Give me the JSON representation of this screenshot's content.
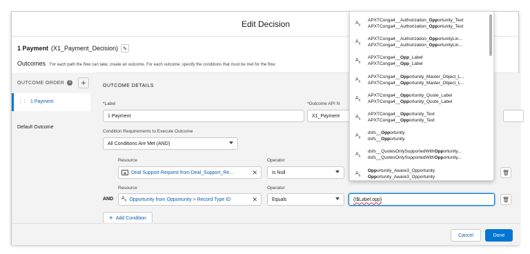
{
  "modal": {
    "title": "Edit Decision"
  },
  "decision": {
    "name": "1 Payment",
    "api_name": "(X1_Payment_Decision)"
  },
  "outcomes": {
    "title": "Outcomes",
    "description": "For each path the flow can take, create an outcome. For each outcome, specify the conditions that must be met for the flow"
  },
  "outcome_order": {
    "label": "OUTCOME ORDER",
    "items": [
      {
        "label": "1 Payment"
      }
    ],
    "default_outcome": "Default Outcome"
  },
  "details": {
    "title": "OUTCOME DETAILS",
    "label_field": {
      "label": "Label",
      "value": "1 Payment"
    },
    "api_field": {
      "label": "Outcome API N",
      "value": "X1_Payment"
    },
    "condition_req": {
      "label": "Condition Requirements to Execute Outcome",
      "value": "All Conditions Are Met (AND)"
    },
    "conditions": [
      {
        "resource_label": "Resource",
        "resource_value": "Deal Support Request from Deal_Support_Re...",
        "operator_label": "Operator",
        "operator_value": "Is Null"
      },
      {
        "and_label": "AND",
        "resource_label": "Resource",
        "resource_value": "Opportunity from Opportunity > Record Type ID",
        "operator_label": "Operator",
        "operator_value": "Equals",
        "value": "{!$Label.opp}"
      }
    ],
    "add_condition": "Add Condition"
  },
  "footer": {
    "cancel": "Cancel",
    "done": "Done"
  },
  "dropdown": {
    "items": [
      {
        "l1": [
          "APXTConga4__Authorization_",
          "Opp",
          "ortunity_Text"
        ],
        "l2": [
          "APXTConga4__Authorization_",
          "Opp",
          "ortunity_Text"
        ]
      },
      {
        "l1": [
          "APXTConga4__Authorization_",
          "Opp",
          "ortunityLin..."
        ],
        "l2": [
          "APXTConga4__Authorization_",
          "Opp",
          "ortunityLin..."
        ]
      },
      {
        "l1": [
          "APXTConga4__",
          "Opp",
          "_Label"
        ],
        "l2": [
          "APXTConga4__",
          "Opp",
          "_Label"
        ]
      },
      {
        "l1": [
          "APXTConga4__",
          "Opp",
          "ortunity_Master_Object_L..."
        ],
        "l2": [
          "APXTConga4__",
          "Opp",
          "ortunity_Master_Object_L..."
        ]
      },
      {
        "l1": [
          "APXTConga4__",
          "Opp",
          "ortunity_Quote_Label"
        ],
        "l2": [
          "APXTConga4__",
          "Opp",
          "ortunity_Quote_Label"
        ]
      },
      {
        "l1": [
          "APXTConga4__",
          "Opp",
          "ortunity_Text"
        ],
        "l2": [
          "APXTConga4__",
          "Opp",
          "ortunity_Text"
        ]
      },
      {
        "l1": [
          "dsfs__",
          "Opp",
          "ortunity"
        ],
        "l2": [
          "dsfs__",
          "Opp",
          "ortunity"
        ]
      },
      {
        "l1": [
          "dsfs__QuotesOnlySupportedWith",
          "Opp",
          "ortunity..."
        ],
        "l2": [
          "dsfs__QuotesOnlySupportedWith",
          "Opp",
          "ortunity..."
        ]
      },
      {
        "l1": [
          "",
          "Opp",
          "ortunity_Aware3_Opportunity"
        ],
        "l2": [
          "",
          "Opp",
          "ortunity_Aware3_Opportunity"
        ]
      }
    ]
  },
  "colors": {
    "brand": "#0176d3",
    "link": "#0b5cab",
    "required": "#ba0517"
  }
}
